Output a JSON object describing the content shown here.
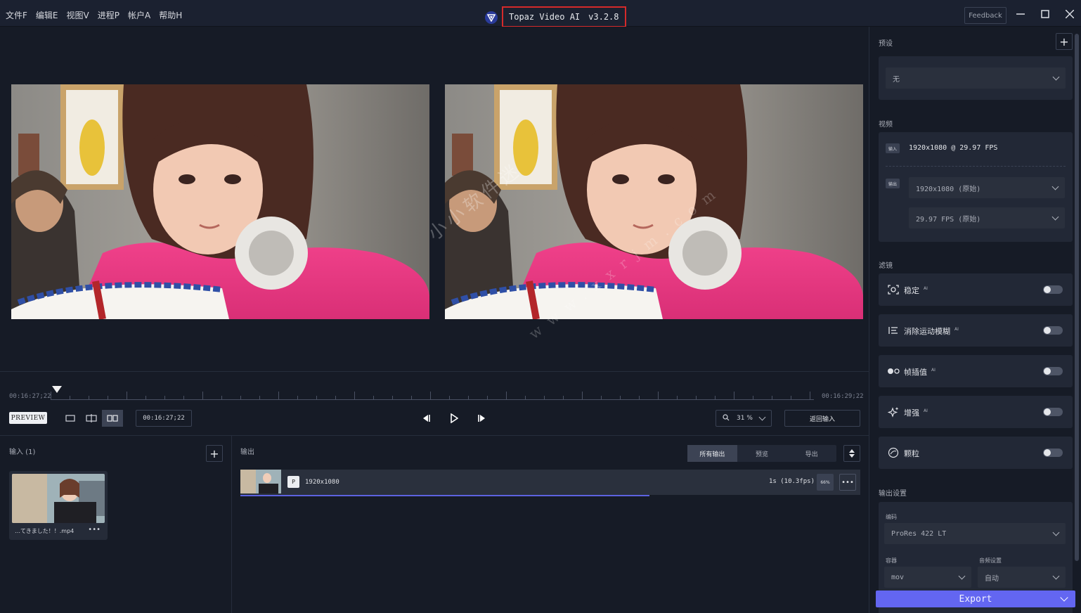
{
  "menu": [
    "文件F",
    "编辑E",
    "视图V",
    "进程P",
    "帐户A",
    "帮助H"
  ],
  "app": {
    "name": "Topaz Video AI",
    "version": "v3.2.8",
    "feedback": "Feedback"
  },
  "timeline": {
    "start_tc": "00:16:27;22",
    "end_tc": "00:16:29;22",
    "current_tc": "00:16:27;22",
    "preview_label": "PREVIEW",
    "zoom_value": "31 %",
    "return_label": "返回输入"
  },
  "input": {
    "title": "输入 (1)",
    "file_name": "…てきました！！.mp4",
    "more": "•••"
  },
  "output": {
    "title": "输出",
    "tabs": [
      "所有输出",
      "预览",
      "导出"
    ],
    "row": {
      "badge": "P",
      "resolution": "1920x1080",
      "time": "1s (10.3fps)",
      "percent": "66%",
      "more": "•••",
      "progress": 0.66
    }
  },
  "sidebar": {
    "preset_label": "预设",
    "preset_value": "无",
    "video_label": "视频",
    "input_tag": "输入",
    "input_info": "1920x1080 @ 29.97 FPS",
    "output_tag": "输出",
    "output_resolution": "1920x1080 (原始)",
    "output_fps": "29.97 FPS (原始)",
    "filters_label": "滤镜",
    "filters": [
      {
        "label": "稳定",
        "ai": "AI",
        "icon": "stabilize-icon"
      },
      {
        "label": "消除运动模糊",
        "ai": "AI",
        "icon": "motion-blur-icon"
      },
      {
        "label": "帧插值",
        "ai": "AI",
        "icon": "frame-interpolation-icon"
      },
      {
        "label": "增强",
        "ai": "AI",
        "icon": "enhance-icon"
      },
      {
        "label": "颗粒",
        "ai": "",
        "icon": "grain-icon"
      }
    ],
    "output_settings_label": "输出设置",
    "encoder_label": "编码",
    "encoder_value": "ProRes 422 LT",
    "container_label": "容器",
    "container_value": "mov",
    "audio_label": "音频设置",
    "audio_value": "自动",
    "export_label": "Export"
  },
  "watermark": {
    "cn": "小小软件迷",
    "url": "www.xxrjm.com"
  }
}
